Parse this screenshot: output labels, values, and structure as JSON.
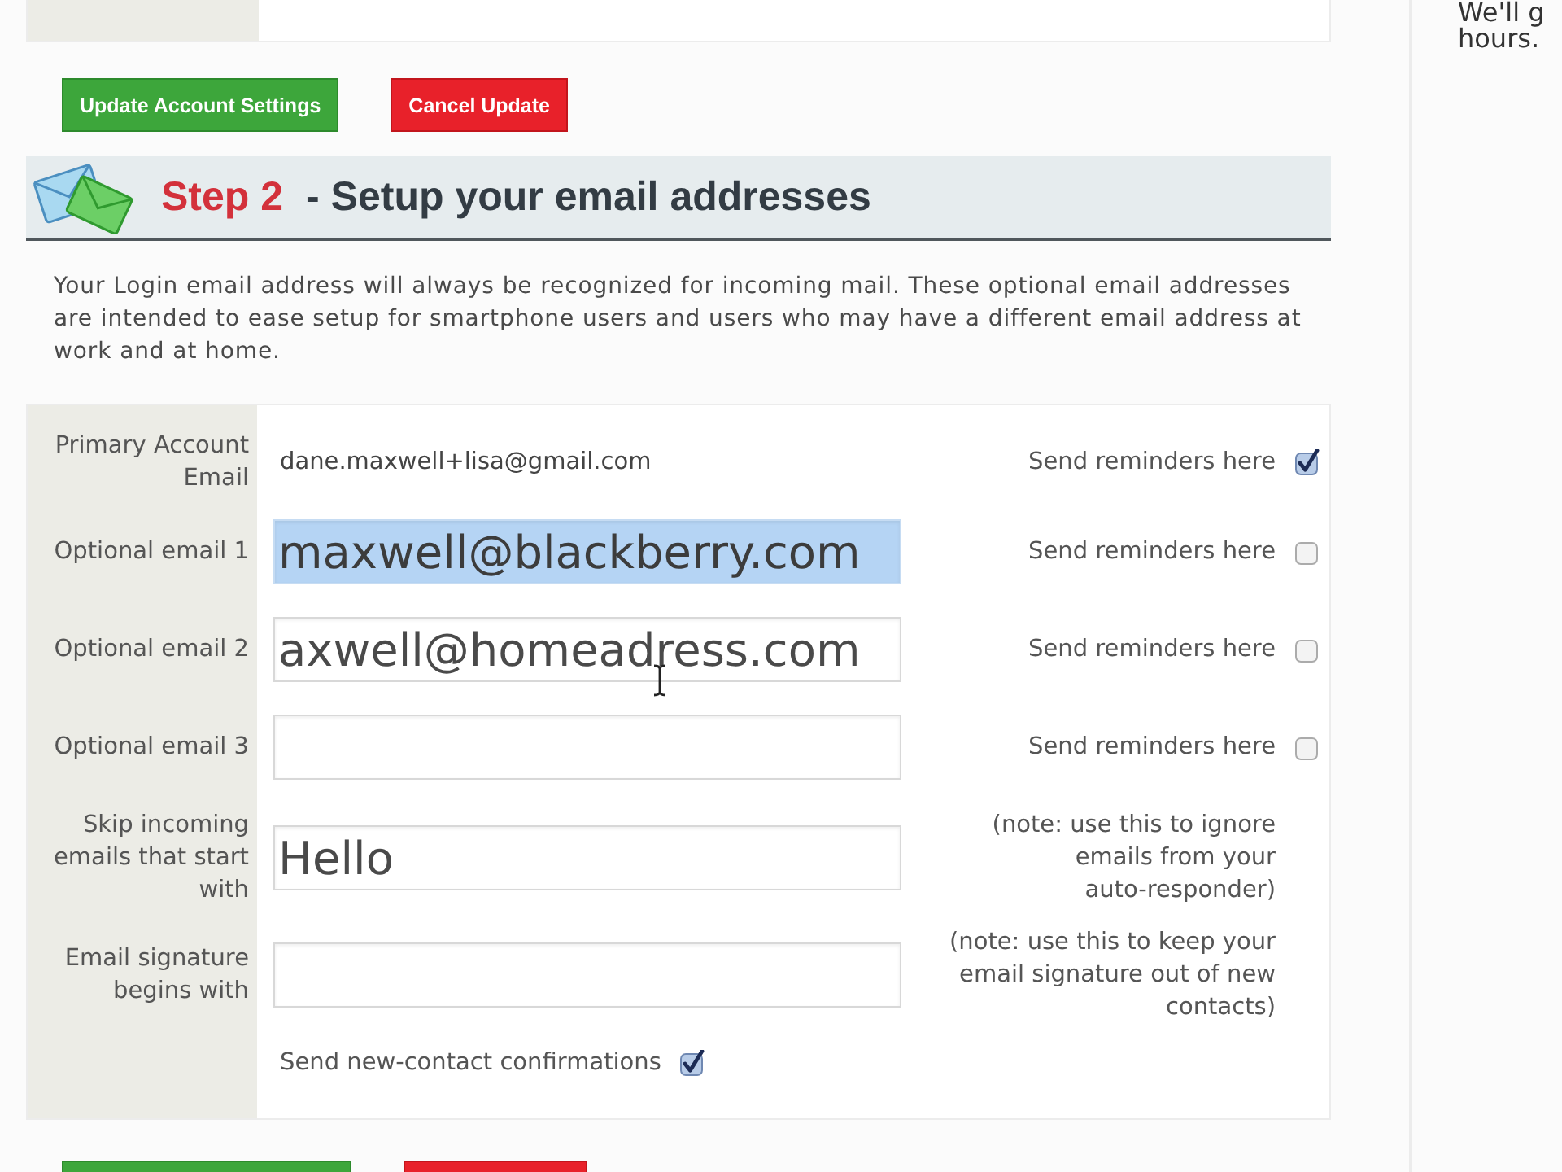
{
  "actions": [
    {
      "kind": "update",
      "label": "Update Account Settings"
    },
    {
      "kind": "cancel",
      "label": "Cancel Update"
    }
  ],
  "step": {
    "number": "Step 2",
    "title": "- Setup your email addresses"
  },
  "intro": "Your Login email address will always be recognized for incoming mail. These optional email addresses are intended to ease setup for smartphone users and users who may have a different email address at work and at home.",
  "form": {
    "rows": [
      {
        "kind": "static",
        "label": "Primary Account Email",
        "value": "dane.maxwell+lisa@gmail.com",
        "option": {
          "label": "Send reminders here",
          "checked": true
        }
      },
      {
        "kind": "input",
        "label": "Optional email 1",
        "value": "maxwell@blackberry.com",
        "highlighted": true,
        "option": {
          "label": "Send reminders here",
          "checked": false
        }
      },
      {
        "kind": "input",
        "label": "Optional email 2",
        "value": "axwell@homeadress.com",
        "highlighted": false,
        "text_cursor": true,
        "option": {
          "label": "Send reminders here",
          "checked": false
        }
      },
      {
        "kind": "input",
        "label": "Optional email 3",
        "highlighted": false,
        "option": {
          "label": "Send reminders here",
          "checked": false
        }
      },
      {
        "kind": "input",
        "label": "Skip incoming emails that start with",
        "value": "Hello",
        "highlighted": false,
        "note": "(note: use this to ignore emails from your auto-responder)"
      },
      {
        "kind": "input",
        "label": "Email signature begins with",
        "highlighted": false,
        "note": "(note: use this to keep your email signature out of new contacts)"
      },
      {
        "kind": "checkbox",
        "label": "Send new-contact confirmations",
        "checked": true
      }
    ]
  },
  "bottom_actions": [
    {
      "kind": "update"
    },
    {
      "kind": "cancel"
    }
  ],
  "sidebar": {
    "lines": [
      "We'll g",
      "hours."
    ]
  }
}
